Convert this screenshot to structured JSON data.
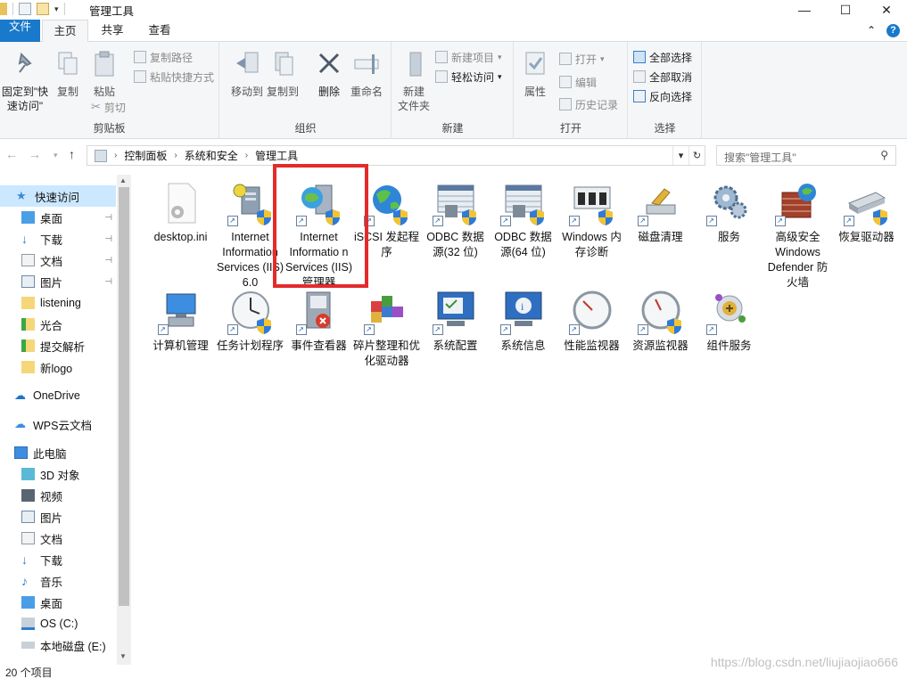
{
  "window": {
    "title": "管理工具"
  },
  "ribbon_tabs": [
    "文件",
    "主页",
    "共享",
    "查看"
  ],
  "ribbon": {
    "clipboard": {
      "pin": "固定到\"快\n速访问\"",
      "copy": "复制",
      "paste": "粘贴",
      "copy_path": "复制路径",
      "paste_shortcut": "粘贴快捷方式",
      "cut": "剪切",
      "label": "剪贴板"
    },
    "organize": {
      "move_to": "移动到",
      "copy_to": "复制到",
      "delete": "删除",
      "rename": "重命名",
      "label": "组织"
    },
    "new": {
      "new_folder_1": "新建",
      "new_folder_2": "文件夹",
      "new_item": "新建项目",
      "easy_access": "轻松访问",
      "label": "新建"
    },
    "open": {
      "properties": "属性",
      "open": "打开",
      "edit": "编辑",
      "history": "历史记录",
      "label": "打开"
    },
    "select": {
      "select_all": "全部选择",
      "select_none": "全部取消",
      "invert": "反向选择",
      "label": "选择"
    }
  },
  "address": {
    "crumbs": [
      "控制面板",
      "系统和安全",
      "管理工具"
    ],
    "search_placeholder": "搜索\"管理工具\""
  },
  "sidebar": {
    "quick_access": "快速访问",
    "quick_items": [
      "桌面",
      "下载",
      "文档",
      "图片",
      "listening",
      "光合",
      "提交解析",
      "新logo"
    ],
    "onedrive": "OneDrive",
    "wps": "WPS云文档",
    "this_pc": "此电脑",
    "pc_items": [
      "3D 对象",
      "视频",
      "图片",
      "文档",
      "下载",
      "音乐",
      "桌面",
      "OS (C:)",
      "本地磁盘 (E:)"
    ]
  },
  "files": [
    "desktop.ini",
    "Internet Information Services (IIS) 6.0",
    "Internet Informatio n Services (IIS)管理器",
    "iSCSI 发起程序",
    "ODBC 数据源(32 位)",
    "ODBC 数据源(64 位)",
    "Windows 内存诊断",
    "磁盘清理",
    "服务",
    "高级安全 Windows Defender 防火墙",
    "恢复驱动器",
    "计算机管理",
    "任务计划程序",
    "事件查看器",
    "碎片整理和优化驱动器",
    "系统配置",
    "系统信息",
    "性能监视器",
    "资源监视器",
    "组件服务"
  ],
  "status": {
    "count": "20 个项目"
  },
  "watermark": "https://blog.csdn.net/liujiaojiao666"
}
